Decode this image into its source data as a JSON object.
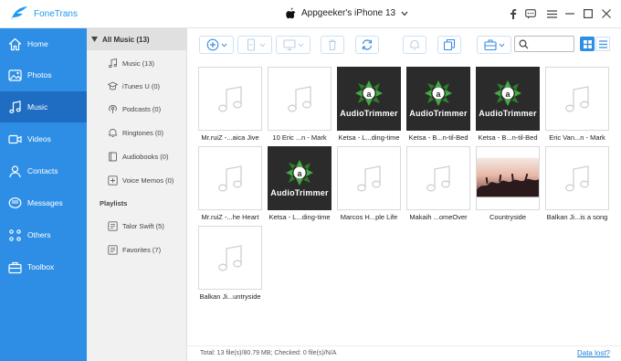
{
  "app": {
    "name": "FoneTrans"
  },
  "device": {
    "name": "Appgeeker's iPhone 13"
  },
  "window_controls": [
    "facebook-icon",
    "chat-icon",
    "menu-icon",
    "minimize-icon",
    "maximize-icon",
    "close-icon"
  ],
  "sidebar": {
    "items": [
      {
        "label": "Home",
        "icon": "home-icon"
      },
      {
        "label": "Photos",
        "icon": "photos-icon"
      },
      {
        "label": "Music",
        "icon": "music-icon",
        "active": true
      },
      {
        "label": "Videos",
        "icon": "videos-icon"
      },
      {
        "label": "Contacts",
        "icon": "contacts-icon"
      },
      {
        "label": "Messages",
        "icon": "messages-icon"
      },
      {
        "label": "Others",
        "icon": "others-icon"
      },
      {
        "label": "Toolbox",
        "icon": "toolbox-icon"
      }
    ]
  },
  "subpanel": {
    "header": "All Music (13)",
    "items": [
      {
        "label": "Music (13)",
        "icon": "music-note-icon"
      },
      {
        "label": "iTunes U (0)",
        "icon": "itunes-u-icon"
      },
      {
        "label": "Podcasts (0)",
        "icon": "podcast-icon"
      },
      {
        "label": "Ringtones (0)",
        "icon": "bell-icon"
      },
      {
        "label": "Audiobooks (0)",
        "icon": "book-icon"
      },
      {
        "label": "Voice Memos (0)",
        "icon": "voice-memo-icon"
      }
    ],
    "playlists_title": "Playlists",
    "playlists": [
      {
        "label": "Talor Swift (5)",
        "icon": "playlist-icon"
      },
      {
        "label": "Favorites (7)",
        "icon": "playlist-icon"
      }
    ]
  },
  "search": {
    "value": "",
    "placeholder": ""
  },
  "tracks": [
    {
      "caption": "Mr.ruiZ -...aica Jive",
      "art": "none"
    },
    {
      "caption": "10 Eric ...n - Mark",
      "art": "none"
    },
    {
      "caption": "Ketsa - L...ding-time",
      "art": "audiotrimmer"
    },
    {
      "caption": "Ketsa - B...n-til-Bed",
      "art": "audiotrimmer"
    },
    {
      "caption": "Ketsa - B...n-til-Bed",
      "art": "audiotrimmer"
    },
    {
      "caption": "Eric Van...n - Mark",
      "art": "none"
    },
    {
      "caption": "Mr.ruiZ -...he Heart",
      "art": "none"
    },
    {
      "caption": "Ketsa - L...ding-time",
      "art": "audiotrimmer"
    },
    {
      "caption": "Marcos H...ple Life",
      "art": "none"
    },
    {
      "caption": "Makaih ...omeOver",
      "art": "none"
    },
    {
      "caption": "Countryside",
      "art": "concert"
    },
    {
      "caption": "Balkan Ji...is a song",
      "art": "none"
    },
    {
      "caption": "Balkan Ji...untryside",
      "art": "none"
    }
  ],
  "art_label": "AudioTrimmer",
  "status": {
    "text": "Total: 13 file(s)/80.79 MB; Checked: 0 file(s)/N/A",
    "link": "Data lost?"
  },
  "colors": {
    "sidebar": "#2e8ee5",
    "sidebar_active": "#1f6dc2",
    "accent": "#1a9af0"
  }
}
